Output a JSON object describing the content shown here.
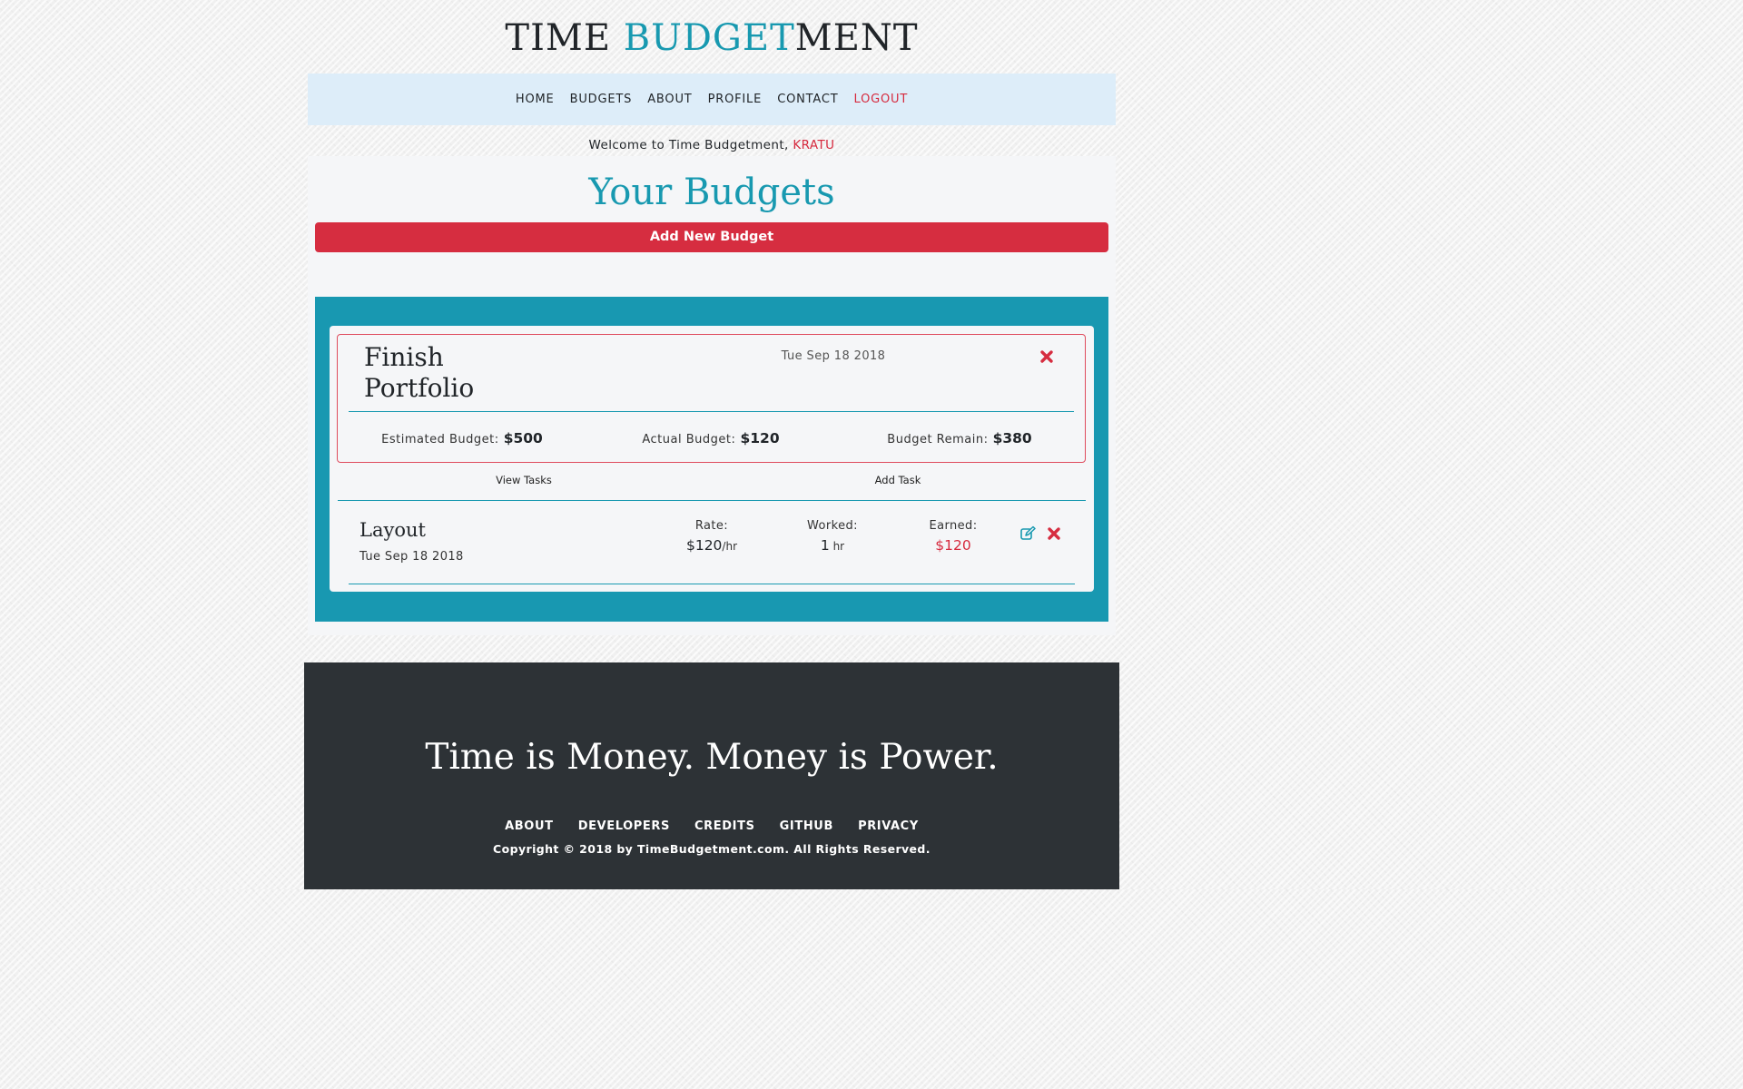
{
  "header": {
    "title_part1": "TIME ",
    "title_accent": "BUDGET",
    "title_part2": "MENT"
  },
  "nav": {
    "items": [
      {
        "label": "HOME"
      },
      {
        "label": "BUDGETS"
      },
      {
        "label": "ABOUT"
      },
      {
        "label": "PROFILE"
      },
      {
        "label": "CONTACT"
      },
      {
        "label": "LOGOUT"
      }
    ]
  },
  "welcome": {
    "text": "Welcome to Time Budgetment, ",
    "username": "KRATU"
  },
  "main": {
    "heading": "Your Budgets",
    "add_button_label": "Add New Budget"
  },
  "budget": {
    "name_line1": "Finish",
    "name_line2": "Portfolio",
    "date": "Tue Sep 18 2018",
    "delete_icon": "times-icon",
    "estimated_label": "Estimated Budget:",
    "estimated_value": "$500",
    "actual_label": "Actual Budget:",
    "actual_value": "$120",
    "remain_label": "Budget Remain:",
    "remain_value": "$380",
    "view_tasks_label": "View Tasks",
    "add_task_label": "Add Task"
  },
  "task": {
    "name": "Layout",
    "date": "Tue Sep 18 2018",
    "rate_label": "Rate:",
    "rate_value": "$120",
    "rate_unit": "/hr",
    "worked_label": "Worked:",
    "worked_value": "1",
    "worked_unit": " hr",
    "earned_label": "Earned:",
    "earned_value": "$120",
    "edit_icon": "edit-icon",
    "delete_icon": "times-icon"
  },
  "footer": {
    "slogan": "Time is Money. Money is Power.",
    "links": [
      {
        "label": "ABOUT"
      },
      {
        "label": "DEVELOPERS"
      },
      {
        "label": "CREDITS"
      },
      {
        "label": "GITHUB"
      },
      {
        "label": "PRIVACY"
      }
    ],
    "copyright": "Copyright © 2018 by TimeBudgetment.com. All Rights Reserved."
  },
  "colors": {
    "accent": "#1899b0",
    "danger": "#d62d40",
    "nav_background": "#ddedf9",
    "footer_background": "#2d3236"
  }
}
